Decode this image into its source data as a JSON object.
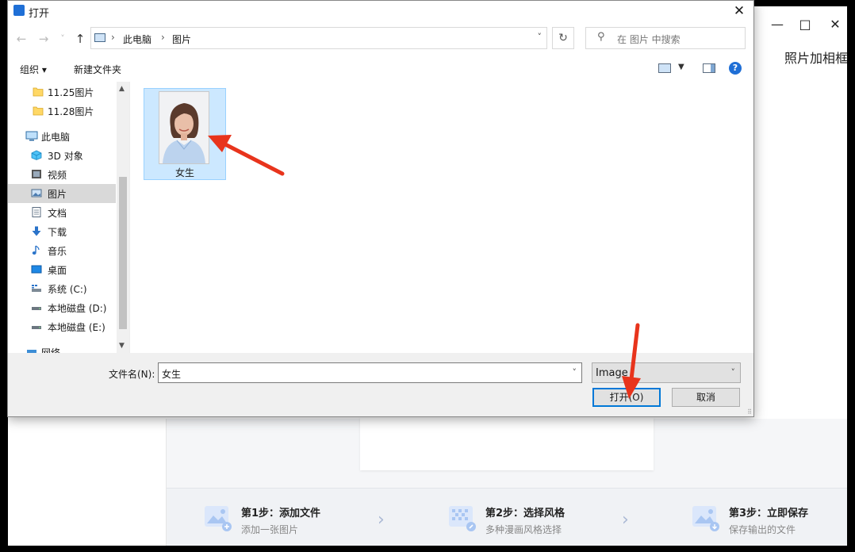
{
  "app": {
    "title": "照片加相框",
    "controls": {
      "minimize": "—",
      "maximize": "□",
      "close": "✕"
    },
    "steps": [
      {
        "title": "第1步：添加文件",
        "subtitle": "添加一张图片"
      },
      {
        "title": "第2步：选择风格",
        "subtitle": "多种漫画风格选择"
      },
      {
        "title": "第3步：立即保存",
        "subtitle": "保存输出的文件"
      }
    ]
  },
  "dialog": {
    "title": "打开",
    "close": "✕",
    "nav": {
      "back": "←",
      "forward": "→",
      "recent": "˅",
      "up": "↑"
    },
    "address": {
      "crumbs": [
        "此电脑",
        "图片"
      ],
      "separator": "›",
      "dropdown": "˅"
    },
    "refresh": "↻",
    "search": {
      "placeholder": "在 图片 中搜索",
      "icon": "search-icon"
    },
    "toolbar": {
      "organize": "组织 ▾",
      "new_folder": "新建文件夹",
      "help": "?"
    },
    "nav_pane": {
      "items": [
        {
          "label": "11.25图片",
          "icon": "folder-icon"
        },
        {
          "label": "11.28图片",
          "icon": "folder-icon"
        },
        {
          "label": "此电脑",
          "icon": "computer-icon"
        },
        {
          "label": "3D 对象",
          "icon": "cube-icon"
        },
        {
          "label": "视频",
          "icon": "video-icon"
        },
        {
          "label": "图片",
          "icon": "pictures-icon",
          "selected": true
        },
        {
          "label": "文档",
          "icon": "document-icon"
        },
        {
          "label": "下载",
          "icon": "download-icon"
        },
        {
          "label": "音乐",
          "icon": "music-icon"
        },
        {
          "label": "桌面",
          "icon": "desktop-icon"
        },
        {
          "label": "系统 (C:)",
          "icon": "system-drive-icon"
        },
        {
          "label": "本地磁盘 (D:)",
          "icon": "drive-icon"
        },
        {
          "label": "本地磁盘 (E:)",
          "icon": "drive-icon"
        },
        {
          "label": "网络",
          "icon": "network-icon"
        }
      ],
      "scroll_up": "▲",
      "scroll_down": "▼"
    },
    "files": [
      {
        "name": "女生",
        "selected": true
      }
    ],
    "filename_label": "文件名(N):",
    "filename_value": "女生",
    "filetype_value": "Image",
    "open_button": "打开(O)",
    "cancel_button": "取消"
  },
  "colors": {
    "accent": "#0078d7",
    "selection": "#cce8ff",
    "annotation": "#e8341c"
  }
}
